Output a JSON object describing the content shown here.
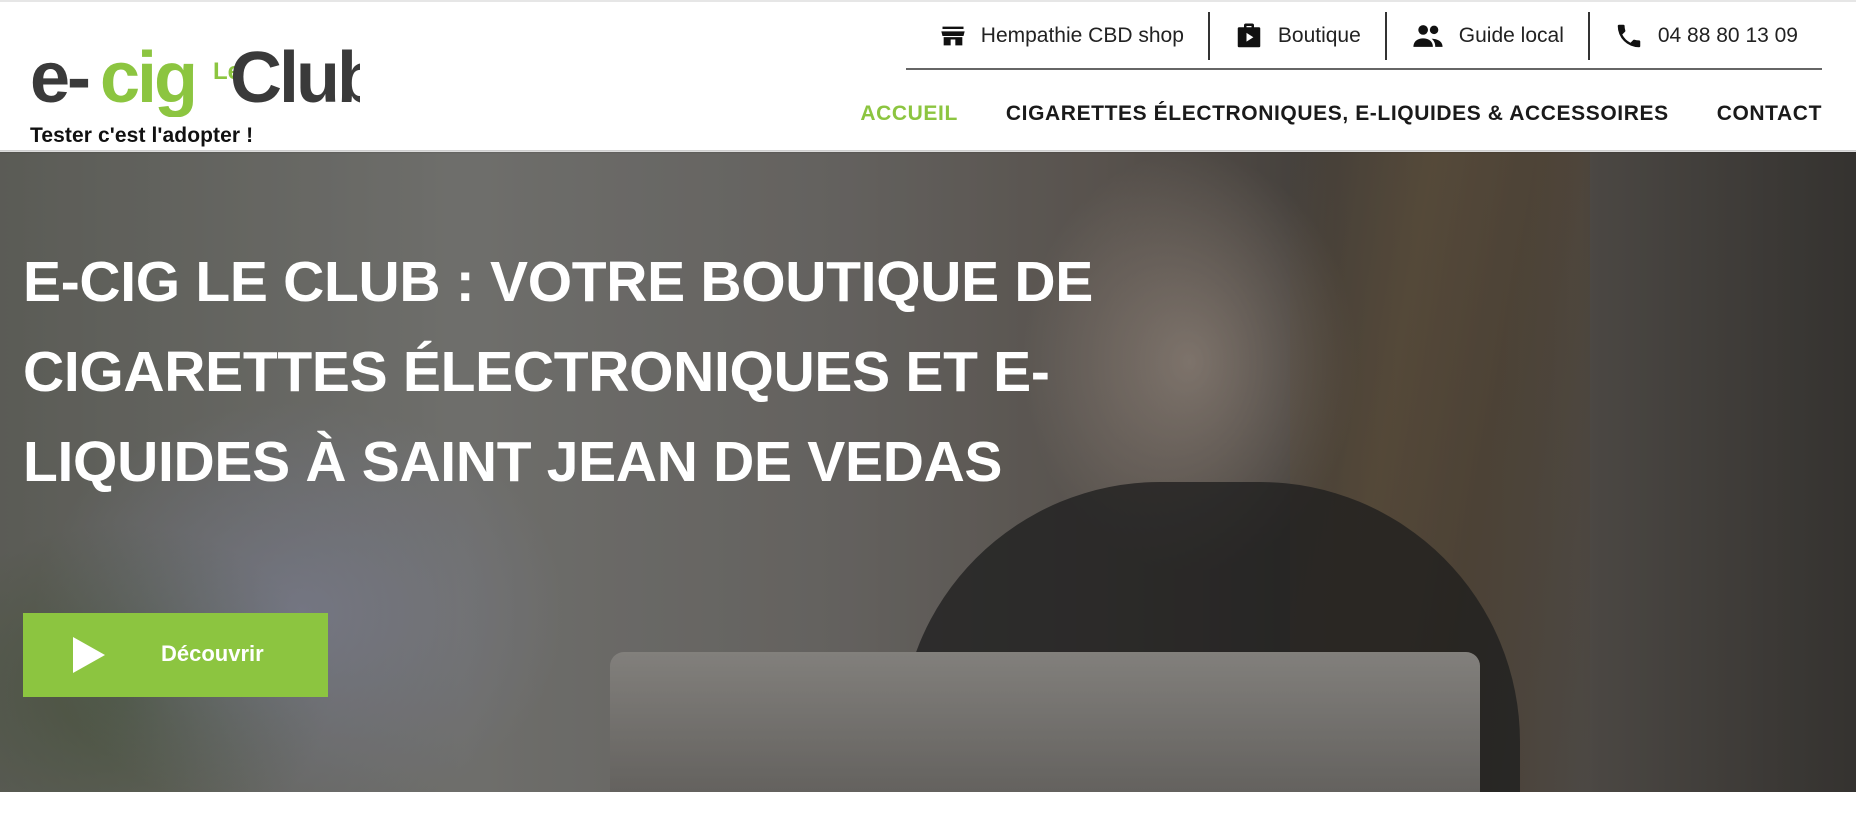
{
  "brand": {
    "logo_text": "e-cigLeClub",
    "logo_part_e": "e-",
    "logo_part_cig": "cig",
    "logo_part_le": "Le",
    "logo_part_club": "Club",
    "tagline": "Tester c'est l'adopter !",
    "colors": {
      "accent": "#8cc540",
      "dark": "#3a3a3a"
    }
  },
  "utility_links": [
    {
      "label": "Hempathie CBD shop",
      "icon": "storefront-icon"
    },
    {
      "label": "Boutique",
      "icon": "shopping-bag-play-icon"
    },
    {
      "label": "Guide local",
      "icon": "people-icon"
    },
    {
      "label": "04 88 80 13 09",
      "icon": "phone-icon"
    }
  ],
  "nav": [
    {
      "label": "ACCUEIL",
      "active": true
    },
    {
      "label": "CIGARETTES ÉLECTRONIQUES, E-LIQUIDES & ACCESSOIRES",
      "active": false
    },
    {
      "label": "CONTACT",
      "active": false
    }
  ],
  "hero": {
    "title": "E-CIG LE CLUB : VOTRE BOUTIQUE DE CIGARETTES ÉLECTRONIQUES ET E-LIQUIDES À SAINT JEAN DE VEDAS",
    "cta_label": "Découvrir",
    "cta_icon": "play-icon"
  }
}
